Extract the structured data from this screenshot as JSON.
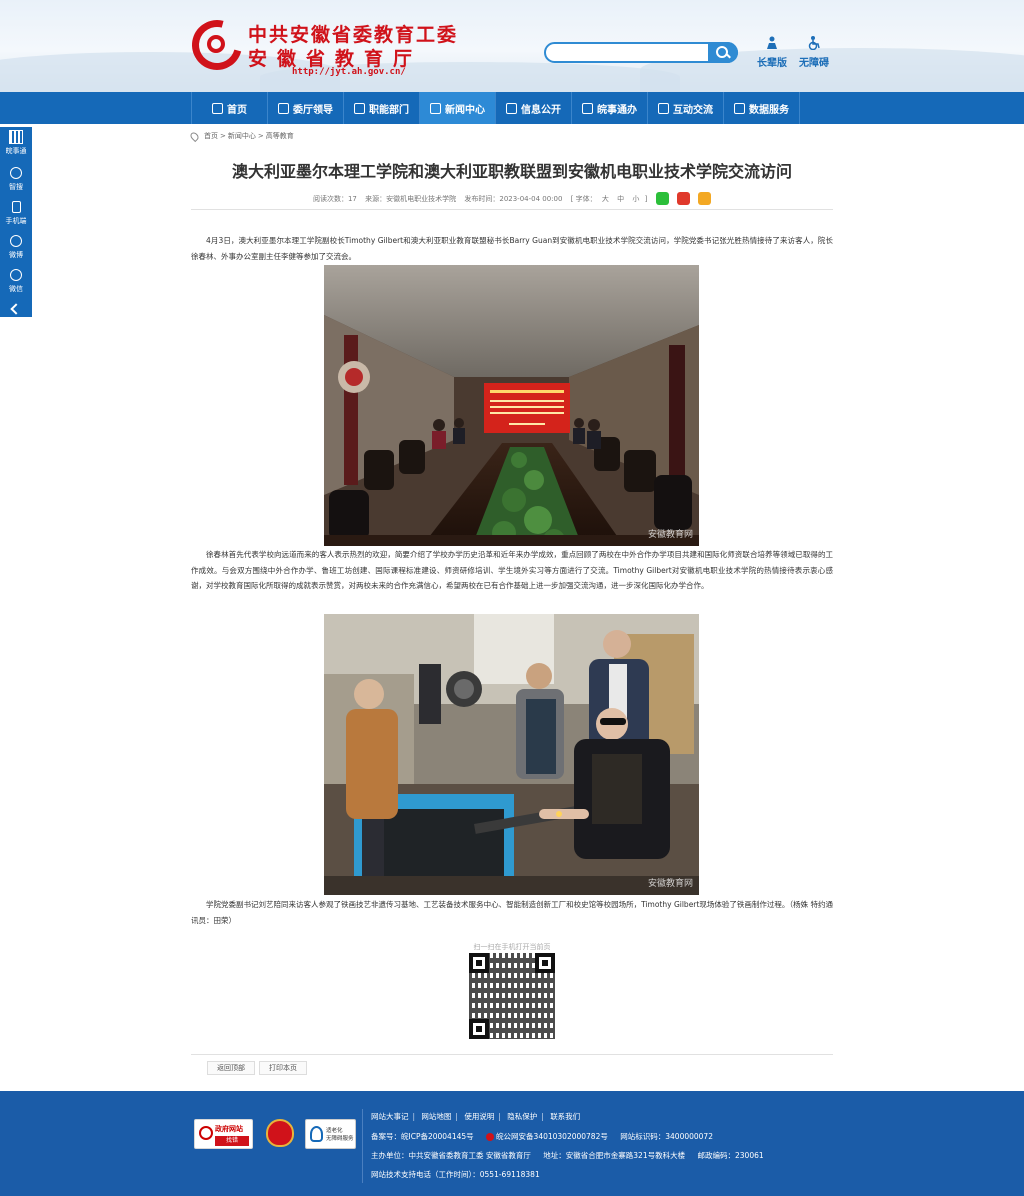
{
  "header": {
    "logo_line1": "中共安徽省委教育工委",
    "logo_line2": "安徽省教育厅",
    "logo_url": "http://jyt.ah.gov.cn/",
    "search_placeholder": "",
    "tool_elder": "长辈版",
    "tool_access": "无障碍"
  },
  "nav": {
    "items": [
      "首页",
      "委厅领导",
      "职能部门",
      "新闻中心",
      "信息公开",
      "皖事通办",
      "互动交流",
      "数据服务"
    ],
    "active_index": 3
  },
  "float": {
    "items": [
      "皖事通",
      "智搜",
      "手机端",
      "微博",
      "微信"
    ]
  },
  "breadcrumb": {
    "home": "首页",
    "sep1": ">",
    "section": "新闻中心",
    "sep2": ">",
    "current": "高等教育"
  },
  "article": {
    "title": "澳大利亚墨尔本理工学院和澳大利亚职教联盟到安徽机电职业技术学院交流访问",
    "meta": {
      "views_label": "阅读次数：",
      "views": "17",
      "source_label": "来源：",
      "source": "安徽机电职业技术学院",
      "date_label": "发布时间：",
      "date": "2023-04-04 00:00",
      "font_label": "[ 字体：",
      "font_large": "大",
      "font_mid": "中",
      "font_small": "小",
      "font_close": "]"
    },
    "paragraphs": [
      "4月3日，澳大利亚墨尔本理工学院副校长Timothy Gilbert和澳大利亚职业教育联盟秘书长Barry Guan到安徽机电职业技术学院交流访问，学院党委书记张光胜热情接待了来访客人，院长徐春林、外事办公室副主任李健等参加了交流会。",
      "徐春林首先代表学校向远道而来的客人表示热烈的欢迎，简要介绍了学校办学历史沿革和近年来办学成效，重点回顾了两校在中外合作办学项目共建和国际化师资联合培养等领域已取得的工作成效。与会双方围绕中外合作办学、鲁班工坊创建、国际课程标准建设、师资研修培训、学生境外实习等方面进行了交流。Timothy Gilbert对安徽机电职业技术学院的热情接待表示衷心感谢，对学校教育国际化所取得的成就表示赞赏，对两校未来的合作充满信心，希望两校在已有合作基础上进一步加强交流沟通，进一步深化国际化办学合作。",
      "学院党委副书记刘艺陪同来访客人参观了铁画技艺非遗传习基地、工艺装备技术服务中心、智能制造创新工厂和校史馆等校园场所，Timothy Gilbert现场体验了铁画制作过程。（杨姝 特约通讯员：田荣）"
    ],
    "photo_watermark": "安徽教育网",
    "banner_text": "澳大利亚墨尔本理工学院和澳大利亚职教联盟到安徽机电职业技术学院交流访问"
  },
  "qr": {
    "caption": "扫一扫在手机打开当前页"
  },
  "actions": {
    "back_top": "返回顶部",
    "print": "打印本页"
  },
  "footer": {
    "badge_gov_title": "政府网站",
    "badge_gov_find": "找错",
    "badge_acc": "适老化\n无障碍服务",
    "links": [
      "网站大事记",
      "网站地图",
      "使用说明",
      "隐私保护",
      "联系我们"
    ],
    "icp_label": "备案号：",
    "icp": "皖ICP备20004145号",
    "police": "皖公网安备34010302000782号",
    "site_code_label": "网站标识码：",
    "site_code": "3400000072",
    "host_label": "主办单位：",
    "host": "中共安徽省委教育工委 安徽省教育厅",
    "addr_label": "地址：",
    "addr": "安徽省合肥市金寨路321号教科大楼",
    "zip_label": "邮政编码：",
    "zip": "230061",
    "phone_label": "网站技术支持电话（工作时间）：",
    "phone": "0551-69118381"
  },
  "colors": {
    "brand_blue": "#1569b8",
    "brand_red": "#d0121a",
    "footer_blue": "#1b5ca8"
  }
}
